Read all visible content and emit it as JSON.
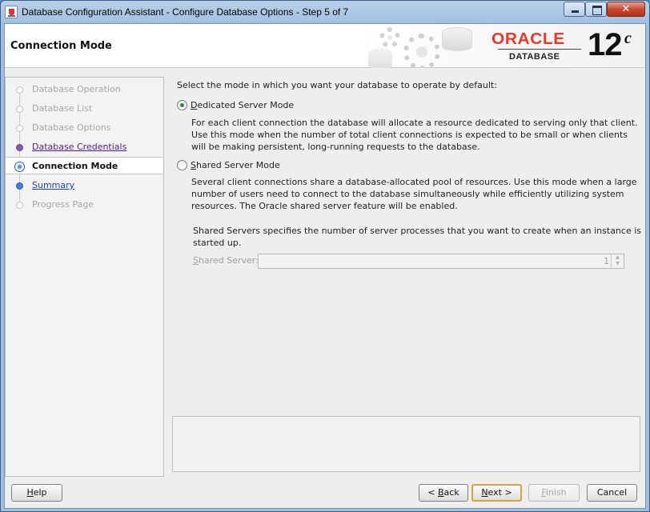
{
  "window": {
    "title": "Database Configuration Assistant - Configure Database Options - Step 5 of 7",
    "close_glyph": "✕"
  },
  "header": {
    "page_title": "Connection Mode",
    "brand": "ORACLE",
    "product": "DATABASE",
    "version": "12",
    "version_suffix": "c"
  },
  "nav": {
    "items": [
      {
        "label": "Database Operation",
        "state": "disabled"
      },
      {
        "label": "Database List",
        "state": "disabled"
      },
      {
        "label": "Database Options",
        "state": "disabled"
      },
      {
        "label": "Database Credentials",
        "state": "visited"
      },
      {
        "label": "Connection Mode",
        "state": "current"
      },
      {
        "label": "Summary",
        "state": "link"
      },
      {
        "label": "Progress Page",
        "state": "disabled"
      }
    ]
  },
  "main": {
    "intro": "Select the mode in which you want your database to operate by default:",
    "dedicated": {
      "label_mnemonic": "D",
      "label_rest": "edicated Server Mode",
      "selected": true,
      "description_lines": [
        "For each client connection the database will allocate a resource dedicated to serving only that client.",
        "Use this mode when the number of total client connections is expected to be small or when clients",
        "will be making persistent, long-running requests to the database."
      ]
    },
    "shared": {
      "label_mnemonic": "S",
      "label_rest": "hared Server Mode",
      "selected": false,
      "description_lines": [
        "Several client connections share a database-allocated pool of resources.  Use this mode when a large",
        "number of users need to connect to the database simultaneously while efficiently utilizing system",
        "resources.  The Oracle shared server feature will be enabled."
      ],
      "servers_note_lines": [
        "Shared Servers specifies the number of server processes that you want to create when an instance is",
        "started up."
      ],
      "field_label_mnemonic": "S",
      "field_label_rest": "hared Server:",
      "field_value": "1",
      "field_enabled": false
    }
  },
  "buttons": {
    "help": {
      "mnemonic": "H",
      "rest": "elp"
    },
    "back": {
      "prefix": "< ",
      "mnemonic": "B",
      "rest": "ack"
    },
    "next": {
      "mnemonic": "N",
      "rest": "ext >"
    },
    "finish": {
      "mnemonic": "F",
      "rest": "inish",
      "enabled": false
    },
    "cancel": {
      "label": "Cancel"
    }
  }
}
